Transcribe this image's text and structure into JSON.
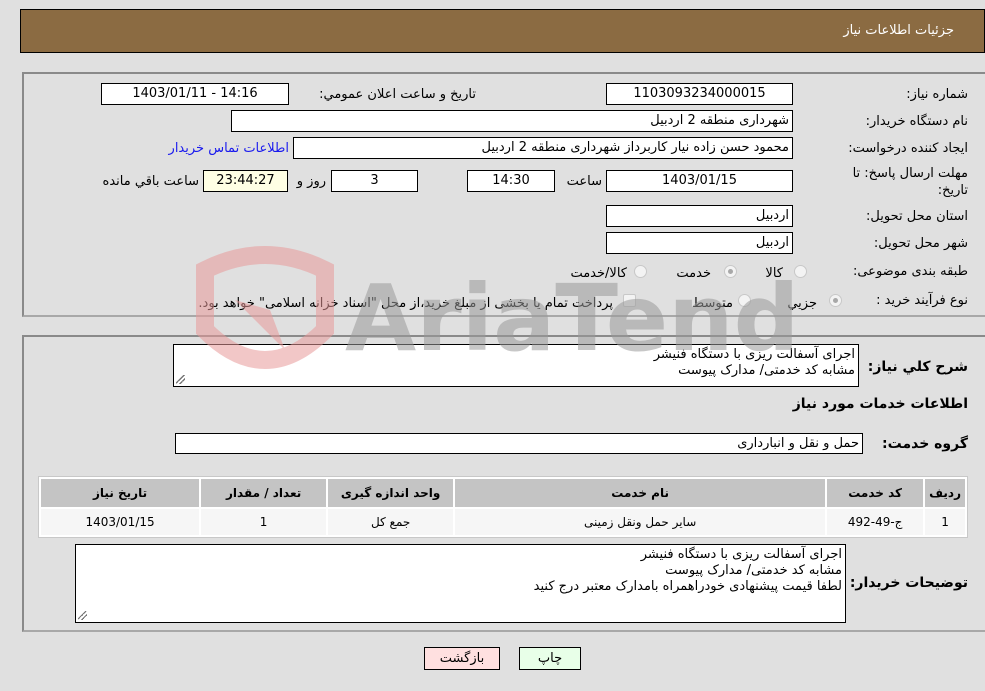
{
  "header": {
    "title": "جزئیات اطلاعات نیاز"
  },
  "form": {
    "need_number": {
      "label": "شماره نیاز:",
      "value": "1103093234000015"
    },
    "announce_datetime": {
      "label": "تاریخ و ساعت اعلان عمومي:",
      "value": "1403/01/11 - 14:16"
    },
    "buyer_org": {
      "label": "نام دستگاه خريدار:",
      "value": "شهرداری منطقه 2 اردبیل"
    },
    "requester": {
      "label": "ايجاد کننده درخواست:",
      "value": "محمود حسن زاده نیار کاربرداز شهرداری منطقه 2 اردبیل"
    },
    "buyer_contact_link": "اطلاعات تماس خريدار",
    "deadline": {
      "label_line1": "مهلت ارسال پاسخ: تا",
      "label_line2": "تاريخ:",
      "date": "1403/01/15",
      "time_label": "ساعت",
      "time": "14:30",
      "days": "3",
      "days_label": "روز و",
      "remaining": "23:44:27",
      "remaining_label": "ساعت باقي مانده"
    },
    "province": {
      "label": "استان محل تحويل:",
      "value": "اردبیل"
    },
    "city": {
      "label": "شهر محل تحويل:",
      "value": "اردبیل"
    },
    "category": {
      "label": "طبقه بندی موضوعی:",
      "options": [
        "کالا",
        "خدمت",
        "کالا/خدمت"
      ],
      "selected": "خدمت"
    },
    "purchase_process": {
      "label": "نوع فرآيند خريد :",
      "options": [
        "جزيي",
        "متوسط"
      ],
      "selected": "جزيي",
      "treasury_note": "پرداخت تمام يا بخشی از مبلغ خريد،از محل \"اسناد خزانه اسلامی\" خواهد بود."
    }
  },
  "details": {
    "description_label": "شرح كلي نياز:",
    "description_lines": [
      "اجرای آسفالت ریزی با دستگاه فنیشر",
      "مشابه کد خدمتی/ مدارک پیوست"
    ],
    "services_title": "اطلاعات خدمات مورد نياز",
    "service_group_label": "گروه خدمت:",
    "service_group_value": "حمل و نقل و انبارداری",
    "table": {
      "headers": [
        "رديف",
        "کد خدمت",
        "نام خدمت",
        "واحد اندازه گيری",
        "تعداد / مقدار",
        "تاريخ نياز"
      ],
      "rows": [
        [
          "1",
          "ج-49-492",
          "سایر حمل ونقل زمینی",
          "جمع کل",
          "1",
          "1403/01/15"
        ]
      ]
    },
    "buyer_notes_label": "توضيحات خريدار:",
    "buyer_notes_lines": [
      "اجرای آسفالت ریزی با دستگاه فنیشر",
      "مشابه کد خدمتی/ مدارک پیوست",
      "لطفا قیمت پیشنهادی خودراهمراه بامدارک معتبر درج کنید"
    ]
  },
  "buttons": {
    "print": "چاپ",
    "back": "بازگشت"
  },
  "watermark": "AriaTender.neT"
}
